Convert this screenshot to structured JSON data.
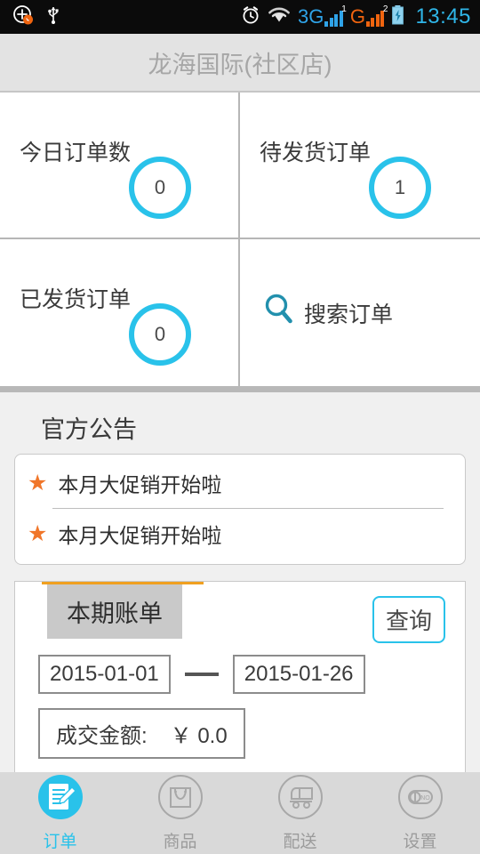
{
  "statusbar": {
    "icons": [
      "call-plus-icon",
      "usb-icon",
      "alarm-clock-icon",
      "wifi-icon",
      "battery-charging-icon"
    ],
    "network_1": "3G",
    "network_1_sup": "1",
    "network_2": "G",
    "network_2_sup": "2",
    "time": "13:45",
    "time_color": "#2fb6e8"
  },
  "header": {
    "title": "龙海国际(社区店)"
  },
  "stats": {
    "accent_color": "#29c2ea",
    "cells": [
      {
        "label": "今日订单数",
        "value": "0"
      },
      {
        "label": "待发货订单",
        "value": "1"
      },
      {
        "label": "已发货订单",
        "value": "0"
      }
    ],
    "search": {
      "label": "搜索订单",
      "icon": "search-icon"
    }
  },
  "notice": {
    "title": "官方公告",
    "star_color": "#f0762a",
    "items": [
      {
        "text": "本月大促销开始啦"
      },
      {
        "text": "本月大促销开始啦"
      }
    ]
  },
  "bill": {
    "tab_label": "本期账单",
    "tab_accent": "#f0a020",
    "query_label": "查询",
    "date_start": "2015-01-01",
    "date_end": "2015-01-26",
    "amount_label": "成交金额:",
    "amount_value": "￥ 0.0"
  },
  "nav": {
    "items": [
      {
        "label": "订单",
        "icon": "order-document-icon",
        "active": true
      },
      {
        "label": "商品",
        "icon": "shopping-bag-icon",
        "active": false
      },
      {
        "label": "配送",
        "icon": "delivery-truck-icon",
        "active": false
      },
      {
        "label": "设置",
        "icon": "toggle-switch-icon",
        "active": false
      }
    ]
  }
}
